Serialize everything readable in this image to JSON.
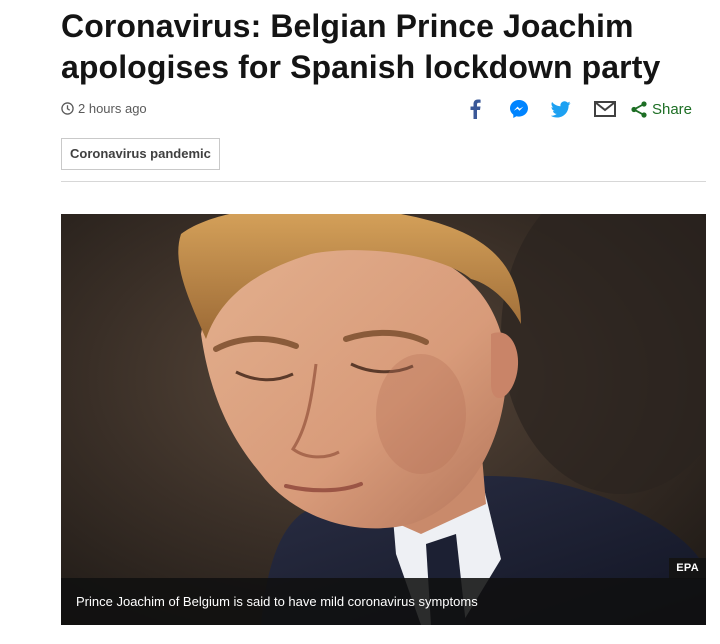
{
  "article": {
    "headline": "Coronavirus: Belgian Prince Joachim apologises for Spanish lockdown party",
    "timestamp": "2 hours ago",
    "share": {
      "label": "Share",
      "icons": [
        "facebook-icon",
        "messenger-icon",
        "twitter-icon",
        "email-icon",
        "share-icon"
      ]
    },
    "tag": "Coronavirus pandemic",
    "image": {
      "credit": "EPA",
      "caption": "Prince Joachim of Belgium is said to have mild coronavirus symptoms"
    }
  },
  "colors": {
    "text": "#141414",
    "meta": "#5a5a5a",
    "facebook": "#3b5998",
    "messenger": "#0084ff",
    "twitter": "#1da1f2",
    "share_green": "#1d6e24"
  }
}
